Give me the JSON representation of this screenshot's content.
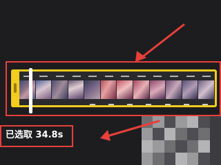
{
  "editor": {
    "selected_duration_label": "已选取 34.8s"
  },
  "timeline": {
    "frame_count": 12
  },
  "colors": {
    "background": "#1d1d1f",
    "selection_border": "#f2cc1f",
    "annotation_red": "#e8403a",
    "playhead": "#ffffff"
  },
  "icons": {
    "trim_handle": "grip-handle-icon"
  }
}
